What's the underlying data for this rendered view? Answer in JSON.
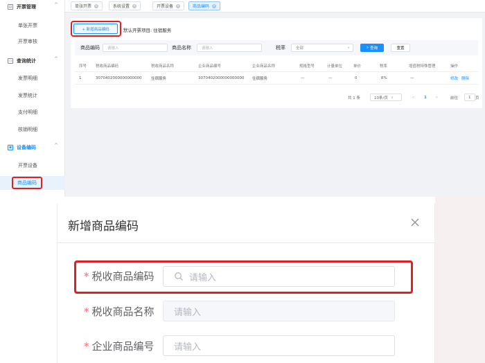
{
  "sidebar": {
    "groups": [
      {
        "label": "开票管理",
        "icon": "invoice-icon",
        "items": [
          "单张开票",
          "开票审核"
        ]
      },
      {
        "label": "查询统计",
        "icon": "chat-icon",
        "items": [
          "发票明细",
          "发票统计",
          "支付明细",
          "核销明细"
        ]
      },
      {
        "label": "设备编码",
        "icon": "device-icon",
        "items": [
          "开票设备",
          "商品编码"
        ]
      }
    ],
    "active_item": "商品编码",
    "caret": "^"
  },
  "tabs": [
    {
      "label": "单张开票",
      "active": false
    },
    {
      "label": "系统设置",
      "active": false
    },
    {
      "label": "开票设备",
      "active": false
    },
    {
      "label": "商品编码",
      "active": true
    }
  ],
  "toolbar": {
    "add_button": "+ 新增商品编码",
    "default_text": "默认开票项目: 住宿服务"
  },
  "filters": {
    "code_label": "商品编码",
    "code_placeholder": "请输入",
    "name_label": "商品名称",
    "name_placeholder": "请输入",
    "tax_label": "税率",
    "tax_value": "全部",
    "query_button": "查询",
    "reset_button": "重置"
  },
  "table": {
    "headers": [
      "序号",
      "税收商品编码",
      "税收商品名称",
      "企业商品编号",
      "企业商品名称",
      "规格型号",
      "计量单位",
      "单价",
      "税率",
      "增值税特殊管理",
      "操作"
    ],
    "rows": [
      [
        "1",
        "3070402000000000000",
        "住宿服务",
        "3070402000000000000",
        "住宿服务",
        "—",
        "—",
        "0",
        "6%",
        "—"
      ]
    ],
    "ops": [
      "修改",
      "删除"
    ]
  },
  "pagination": {
    "total": "共 1 条",
    "page_size": "10条/页",
    "prev": "<",
    "current": "1",
    "next": ">",
    "goto_label": "前往",
    "goto_value": "1",
    "page_suffix": "页"
  },
  "dialog": {
    "title": "新增商品编码",
    "fields": [
      {
        "label": "税收商品编码",
        "placeholder": "请输入"
      },
      {
        "label": "税收商品名称",
        "placeholder": "请输入"
      },
      {
        "label": "企业商品编号",
        "placeholder": "请输入"
      }
    ],
    "required_mark": "*"
  },
  "colors": {
    "primary": "#1890ff",
    "highlight": "#e02020",
    "required": "#f56c6c"
  }
}
